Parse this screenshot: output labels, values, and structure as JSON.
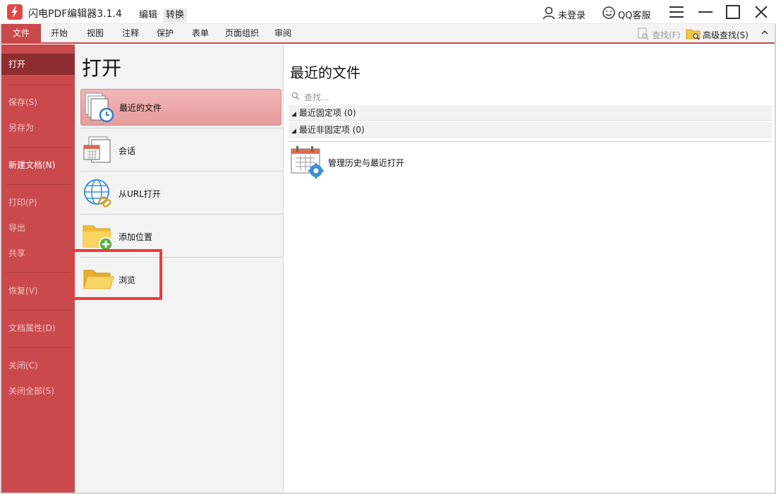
{
  "titlebar": {
    "app_title": "闪电PDF编辑器3.1.4",
    "tabs": [
      "编辑",
      "转换"
    ],
    "login_label": "未登录",
    "qq_label": "QQ客服"
  },
  "ribbon": {
    "tabs": [
      "文件",
      "开始",
      "视图",
      "注释",
      "保护",
      "表单",
      "页面组织",
      "审阅"
    ],
    "active_tab": "文件",
    "find_label": "查找(F)",
    "advanced_find_label": "高级查找(S)"
  },
  "sidebar": {
    "items": [
      "打开",
      "保存(S)",
      "另存为",
      "新建文档(N)",
      "打印(P)",
      "导出",
      "共享",
      "恢复(V)",
      "文档属性(D)",
      "关闭(C)",
      "关闭全部(S)"
    ],
    "active": "打开"
  },
  "open_panel": {
    "title": "打开",
    "items": [
      "最近的文件",
      "会话",
      "从URL打开",
      "添加位置",
      "浏览"
    ],
    "selected": "最近的文件",
    "highlighted": "浏览"
  },
  "recent_panel": {
    "title": "最近的文件",
    "search_placeholder": "查找...",
    "pinned_group": "最近固定项 (0)",
    "unpinned_group": "最近非固定项 (0)",
    "manage_label": "管理历史与最近打开"
  },
  "colors": {
    "accent": "#c9494c",
    "sidebar_active": "#8e2d30",
    "highlight_box": "#ec3a3a"
  }
}
